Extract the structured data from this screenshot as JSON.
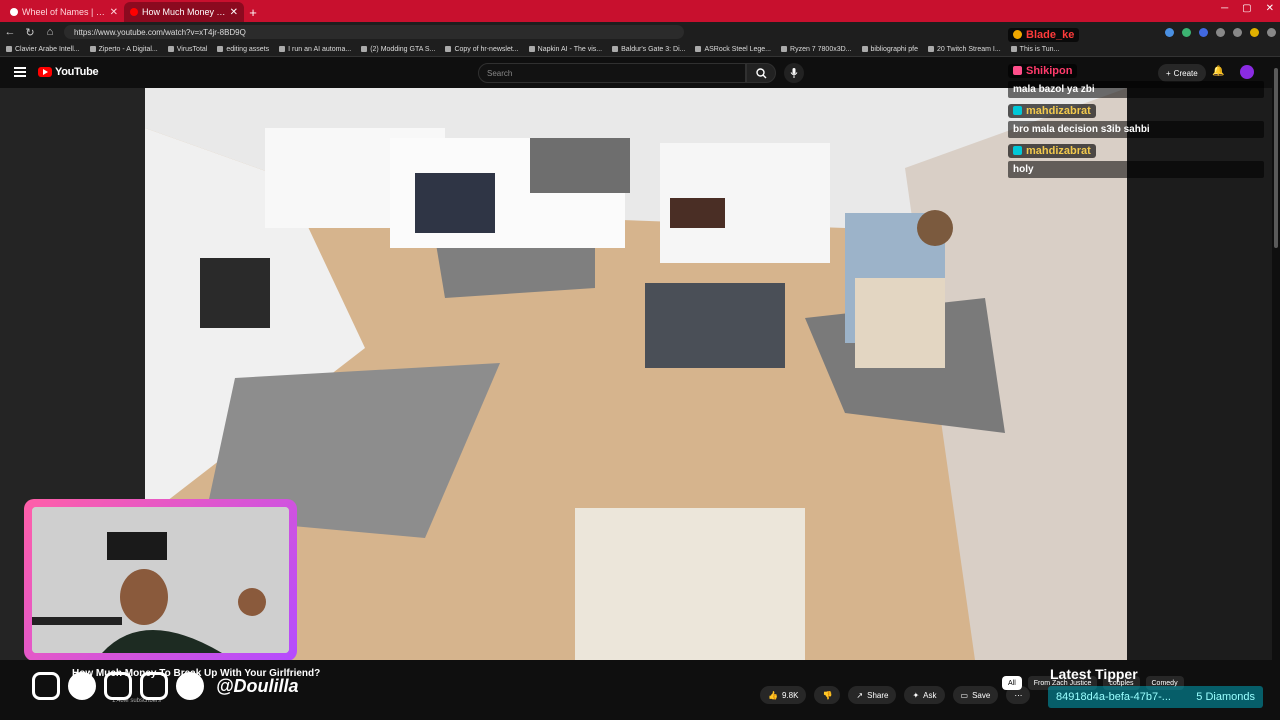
{
  "browser": {
    "tabs": [
      {
        "title": "Wheel of Names | Random name picker",
        "active": false
      },
      {
        "title": "How Much Money To Break Up With Your Girlfriend?",
        "active": true
      }
    ],
    "new_tab": "+",
    "url": "https://www.youtube.com/watch?v=xT4jr-8BD9Q",
    "bookmarks": [
      "Clavier Arabe Intell...",
      "Ziperto - A Digital...",
      "VirusTotal",
      "editing assets",
      "I run an AI automa...",
      "(2) Modding GTA S...",
      "Copy of hr-newslet...",
      "Napkin AI - The vis...",
      "Baldur's Gate 3: Di...",
      "ASRock Steel Lege...",
      "Ryzen 7 7800x3D...",
      "bibliographi pfe",
      "20 Twitch Stream I...",
      "This is Tun..."
    ]
  },
  "youtube": {
    "logo_text": "YouTube",
    "search_placeholder": "Search",
    "create_label": "Create"
  },
  "chat": [
    {
      "user": "Blade_ke",
      "badge": "red",
      "text": ""
    },
    {
      "user": "Shikipon",
      "badge": "pink",
      "text": "mala bazol ya zbi"
    },
    {
      "user": "mahdizabrat",
      "badge": "teal",
      "text": "bro mala decision s3ib sahbi"
    },
    {
      "user": "mahdizabrat",
      "badge": "teal",
      "text": "holy"
    }
  ],
  "video": {
    "title": "How Much Money To Break Up With Your Girlfriend?",
    "subscribers": "1.48M subscribers",
    "likes": "9.8K",
    "share_label": "Share",
    "ask_label": "Ask",
    "save_label": "Save"
  },
  "overlay": {
    "handle": "@Doulilla",
    "tipper_title": "Latest Tipper",
    "tipper_id": "84918d4a-befa-47b7-...",
    "tipper_amount": "5 Diamonds"
  },
  "chips": [
    "All",
    "From Zach Justice",
    "couples",
    "Comedy"
  ]
}
